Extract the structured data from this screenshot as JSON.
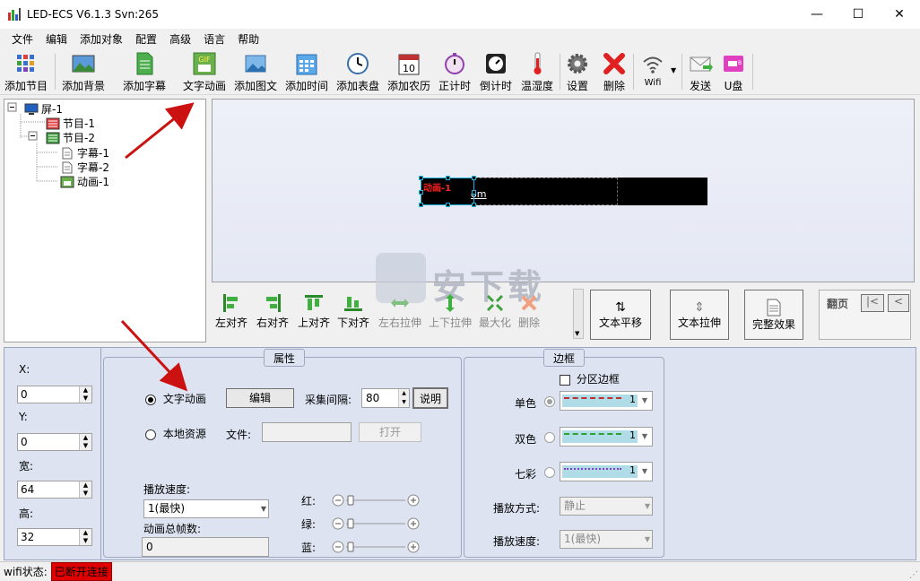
{
  "window": {
    "title": "LED-ECS V6.1.3 Svn:265"
  },
  "menu": [
    "文件",
    "编辑",
    "添加对象",
    "配置",
    "高级",
    "语言",
    "帮助"
  ],
  "toolbar": [
    {
      "name": "add-program-button",
      "label": "添加节目",
      "icon": "grid-icon"
    },
    {
      "name": "add-background-button",
      "label": "添加背景",
      "icon": "landscape-icon"
    },
    {
      "name": "add-subtitle-button",
      "label": "添加字幕",
      "icon": "document-icon"
    },
    {
      "name": "text-animation-button",
      "label": "文字动画",
      "icon": "gif-icon"
    },
    {
      "name": "add-image-text-button",
      "label": "添加图文",
      "icon": "picture-icon"
    },
    {
      "name": "add-time-button",
      "label": "添加时间",
      "icon": "calendar-icon"
    },
    {
      "name": "add-clock-button",
      "label": "添加表盘",
      "icon": "clock-icon"
    },
    {
      "name": "add-lunar-calendar-button",
      "label": "添加农历",
      "icon": "day-calendar-icon"
    },
    {
      "name": "count-up-button",
      "label": "正计时",
      "icon": "stopwatch-icon"
    },
    {
      "name": "countdown-button",
      "label": "倒计时",
      "icon": "timer-icon"
    },
    {
      "name": "temp-humidity-button",
      "label": "温湿度",
      "icon": "thermometer-icon"
    },
    {
      "name": "settings-button",
      "label": "设置",
      "icon": "gear-icon"
    },
    {
      "name": "delete-button",
      "label": "删除",
      "icon": "red-x-icon"
    },
    {
      "name": "wifi-button",
      "label": "Wifi",
      "icon": "wifi-icon"
    },
    {
      "name": "send-button",
      "label": "发送",
      "icon": "envelope-icon"
    },
    {
      "name": "usb-button",
      "label": "U盘",
      "icon": "usb-icon"
    }
  ],
  "tree": {
    "screen": "屏-1",
    "program1": "节目-1",
    "program2": "节目-2",
    "subtitle1": "字幕-1",
    "subtitle2": "字幕-2",
    "animation1": "动画-1"
  },
  "preview": {
    "led_label": "动画-1",
    "led_text": "om"
  },
  "align": [
    {
      "name": "align-left-button",
      "label": "左对齐",
      "icon": "align-left-icon",
      "enabled": true
    },
    {
      "name": "align-right-button",
      "label": "右对齐",
      "icon": "align-right-icon",
      "enabled": true
    },
    {
      "name": "align-top-button",
      "label": "上对齐",
      "icon": "align-top-icon",
      "enabled": true
    },
    {
      "name": "align-bottom-button",
      "label": "下对齐",
      "icon": "align-bottom-icon",
      "enabled": true
    },
    {
      "name": "stretch-horizontal-button",
      "label": "左右拉伸",
      "icon": "horizontal-stretch-icon",
      "enabled": false
    },
    {
      "name": "stretch-vertical-button",
      "label": "上下拉伸",
      "icon": "vertical-stretch-icon",
      "enabled": false
    },
    {
      "name": "maximize-button",
      "label": "最大化",
      "icon": "maximize-icon",
      "enabled": false
    },
    {
      "name": "align-delete-button",
      "label": "删除",
      "icon": "delete-x-icon",
      "enabled": false
    }
  ],
  "effects": {
    "text_pan": "文本平移",
    "text_stretch": "文本拉伸",
    "full_effect": "完整效果",
    "page_turn": "翻页",
    "first_page": "|<",
    "prev_page": "<"
  },
  "position": {
    "x_label": "X:",
    "x_value": "0",
    "y_label": "Y:",
    "y_value": "0",
    "w_label": "宽:",
    "w_value": "64",
    "h_label": "高:",
    "h_value": "32"
  },
  "properties": {
    "title": "属性",
    "text_anim_radio": "文字动画",
    "edit_button": "编辑",
    "interval_label": "采集间隔:",
    "interval_value": "80",
    "help_button": "说明",
    "local_radio": "本地资源",
    "file_label": "文件:",
    "file_value": "",
    "open_button": "打开",
    "speed_label": "播放速度:",
    "speed_value": "1(最快)",
    "frames_label": "动画总帧数:",
    "frames_value": "0",
    "red_label": "红:",
    "green_label": "绿:",
    "blue_label": "蓝:",
    "red_level": 0,
    "green_level": 0,
    "blue_level": 0
  },
  "border": {
    "title": "边框",
    "partition_label": "分区边框",
    "partition_checked": false,
    "single_label": "单色",
    "single_value": "1",
    "dual_label": "双色",
    "dual_value": "1",
    "rainbow_label": "七彩",
    "rainbow_value": "1",
    "play_mode_label": "播放方式:",
    "play_mode_value": "静止",
    "play_speed_label": "播放速度:",
    "play_speed_value": "1(最快)"
  },
  "status": {
    "label": "wifi状态:",
    "value": "已断开连接"
  },
  "watermark": "安下载",
  "colors": {
    "status_red": "#e00000",
    "led_black": "#000000",
    "accent_red": "#cc1111"
  }
}
